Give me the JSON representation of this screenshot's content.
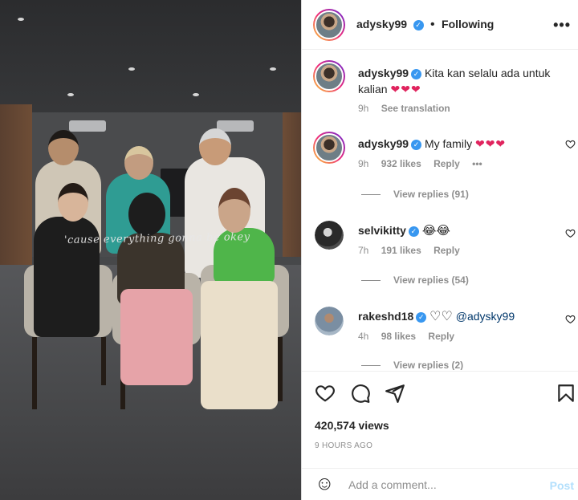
{
  "media": {
    "caption_overlay": "'cause everything gonna be okey"
  },
  "header": {
    "username": "adysky99",
    "separator": "•",
    "follow_status": "Following",
    "more": "•••"
  },
  "comments": [
    {
      "username": "adysky99",
      "text": "Kita kan selalu ada untuk kalian",
      "hearts": "❤❤❤",
      "time": "9h",
      "action": "See translation"
    },
    {
      "username": "adysky99",
      "text": "My family",
      "hearts": "❤❤❤",
      "time": "9h",
      "likes": "932 likes",
      "reply": "Reply",
      "more": "•••",
      "view_replies": "View replies (91)"
    },
    {
      "username": "selvikitty",
      "emoji": "😂😂",
      "time": "7h",
      "likes": "191 likes",
      "reply": "Reply",
      "view_replies": "View replies (54)"
    },
    {
      "username": "rakeshd18",
      "hearts_outline": "♡♡",
      "mention": "@adysky99",
      "time": "4h",
      "likes": "98 likes",
      "reply": "Reply",
      "view_replies": "View replies (2)"
    }
  ],
  "actions": {
    "icons": [
      "heart-icon",
      "comment-icon",
      "share-icon",
      "bookmark-icon"
    ],
    "views": "420,574 views",
    "timestamp": "9 HOURS AGO"
  },
  "add_comment": {
    "emoji_icon": "☺",
    "placeholder": "Add a comment...",
    "post_label": "Post"
  },
  "colors": {
    "verified": "#3897f0",
    "heart": "#e0245e",
    "post_disabled": "#b2dffc",
    "secondary_text": "#8e8e8e"
  }
}
